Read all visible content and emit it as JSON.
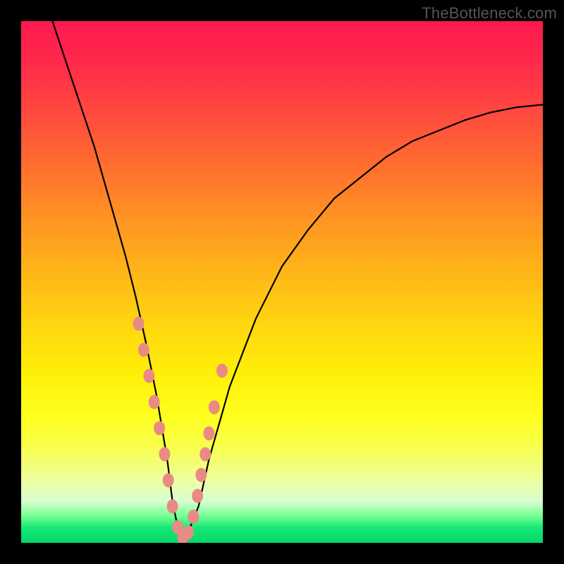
{
  "watermark": "TheBottleneck.com",
  "chart_data": {
    "type": "line",
    "title": "",
    "xlabel": "",
    "ylabel": "",
    "xlim": [
      0,
      100
    ],
    "ylim": [
      0,
      100
    ],
    "grid": false,
    "legend": false,
    "series": [
      {
        "name": "bottleneck-curve",
        "x": [
          6,
          10,
          14,
          18,
          20,
          22,
          24,
          26,
          28,
          29,
          30,
          31,
          32,
          34,
          36,
          40,
          45,
          50,
          55,
          60,
          65,
          70,
          75,
          80,
          85,
          90,
          95,
          100
        ],
        "values": [
          100,
          88,
          76,
          62,
          55,
          47,
          38,
          28,
          16,
          8,
          3,
          1,
          2,
          7,
          16,
          30,
          43,
          53,
          60,
          66,
          70,
          74,
          77,
          79,
          81,
          82.5,
          83.5,
          84
        ]
      }
    ],
    "markers": {
      "name": "highlight-dots",
      "x": [
        22.5,
        23.5,
        24.5,
        25.5,
        26.5,
        27.5,
        28.2,
        29.0,
        30.0,
        31.0,
        32.0,
        33.0,
        33.8,
        34.5,
        35.3,
        36.0,
        37.0,
        38.5
      ],
      "values": [
        42,
        37,
        32,
        27,
        22,
        17,
        12,
        7,
        3,
        1,
        2,
        5,
        9,
        13,
        17,
        21,
        26,
        33
      ],
      "color": "#e98b84",
      "size": 10
    },
    "gradient_stops": [
      {
        "pos": 0,
        "color": "#ff1850"
      },
      {
        "pos": 18,
        "color": "#ff4b3e"
      },
      {
        "pos": 38,
        "color": "#ff9422"
      },
      {
        "pos": 58,
        "color": "#ffd610"
      },
      {
        "pos": 76,
        "color": "#ffff20"
      },
      {
        "pos": 92,
        "color": "#d8ffd0"
      },
      {
        "pos": 100,
        "color": "#00d868"
      }
    ]
  }
}
